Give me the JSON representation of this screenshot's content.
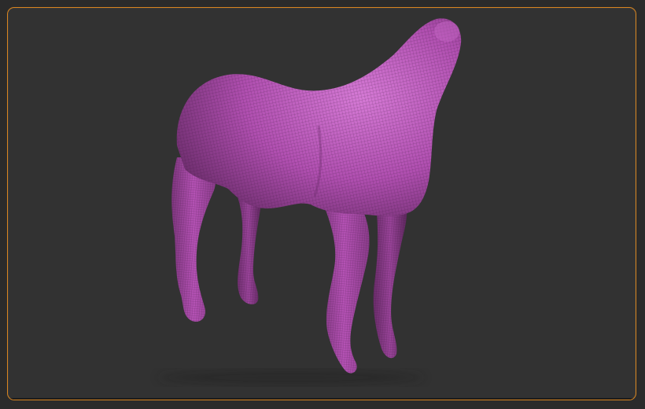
{
  "viewport": {
    "frame_color": "#d9851f",
    "background_color": "#323232"
  },
  "model": {
    "subject": "horse-body-sculpt",
    "material_color": "#b552b5",
    "highlight_color": "#d47ad4",
    "shadow_color": "#4a1f4a",
    "wireframe_visible": true
  }
}
